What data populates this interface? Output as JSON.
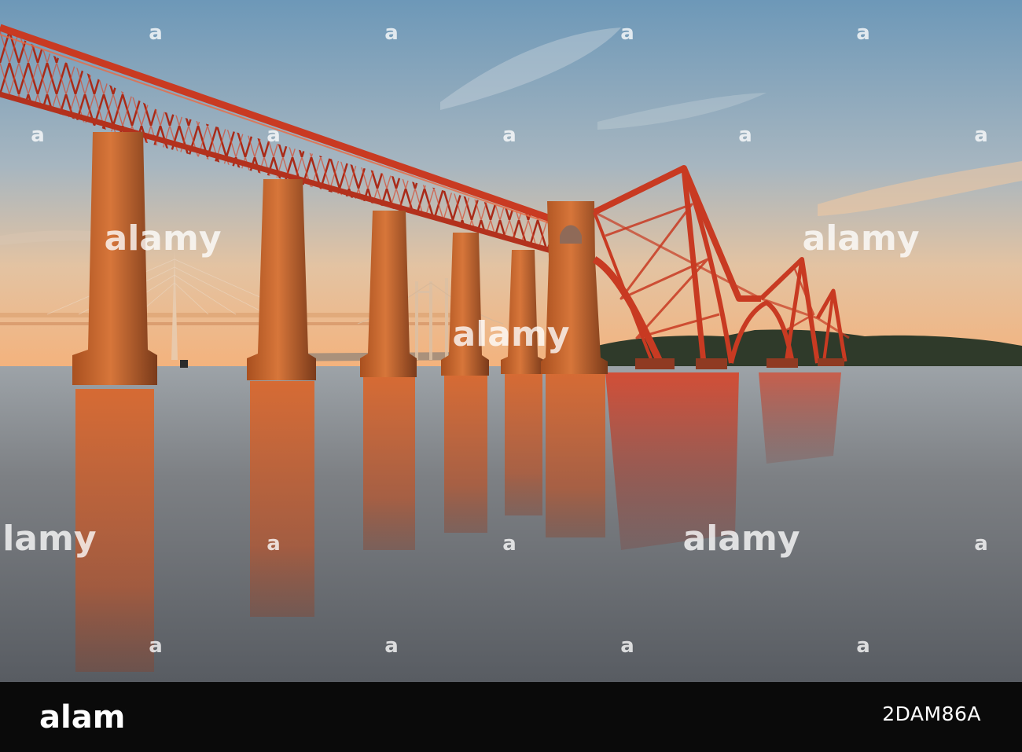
{
  "watermark": {
    "brand": "alamy",
    "mark": "a"
  },
  "footer": {
    "logo_text": "alamy",
    "image_id": "2DAM86A"
  },
  "colors": {
    "sky_top": "#6f9cbc",
    "sky_mid": "#c8c3b8",
    "sky_horizon": "#f3b57f",
    "bridge_red": "#c93a22",
    "pier_orange": "#c8642a",
    "water": "#6f7478",
    "footer_bg": "#0a0a0a"
  },
  "icons": [
    "bridge-illustration"
  ]
}
